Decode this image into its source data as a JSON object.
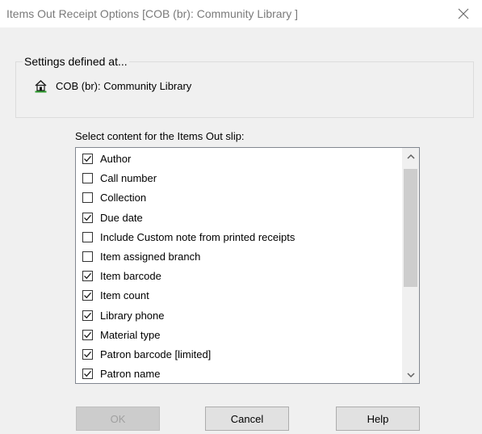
{
  "window": {
    "title": "Items Out Receipt Options [COB (br): Community Library ]"
  },
  "settings": {
    "legend": "Settings defined at...",
    "branch": "COB (br): Community Library"
  },
  "content": {
    "label": "Select content for the Items Out slip:",
    "items": [
      {
        "label": "Author",
        "checked": true
      },
      {
        "label": "Call number",
        "checked": false
      },
      {
        "label": "Collection",
        "checked": false
      },
      {
        "label": "Due date",
        "checked": true
      },
      {
        "label": "Include Custom note from printed receipts",
        "checked": false
      },
      {
        "label": "Item assigned branch",
        "checked": false
      },
      {
        "label": "Item barcode",
        "checked": true
      },
      {
        "label": "Item count",
        "checked": true
      },
      {
        "label": "Library phone",
        "checked": true
      },
      {
        "label": "Material type",
        "checked": true
      },
      {
        "label": "Patron barcode [limited]",
        "checked": true
      },
      {
        "label": "Patron name",
        "checked": true
      }
    ]
  },
  "buttons": {
    "ok": "OK",
    "cancel": "Cancel",
    "help": "Help"
  },
  "icons": {
    "close": "close-icon",
    "branch": "library-building-icon",
    "scroll_up": "chevron-up-icon",
    "scroll_down": "chevron-down-icon"
  }
}
